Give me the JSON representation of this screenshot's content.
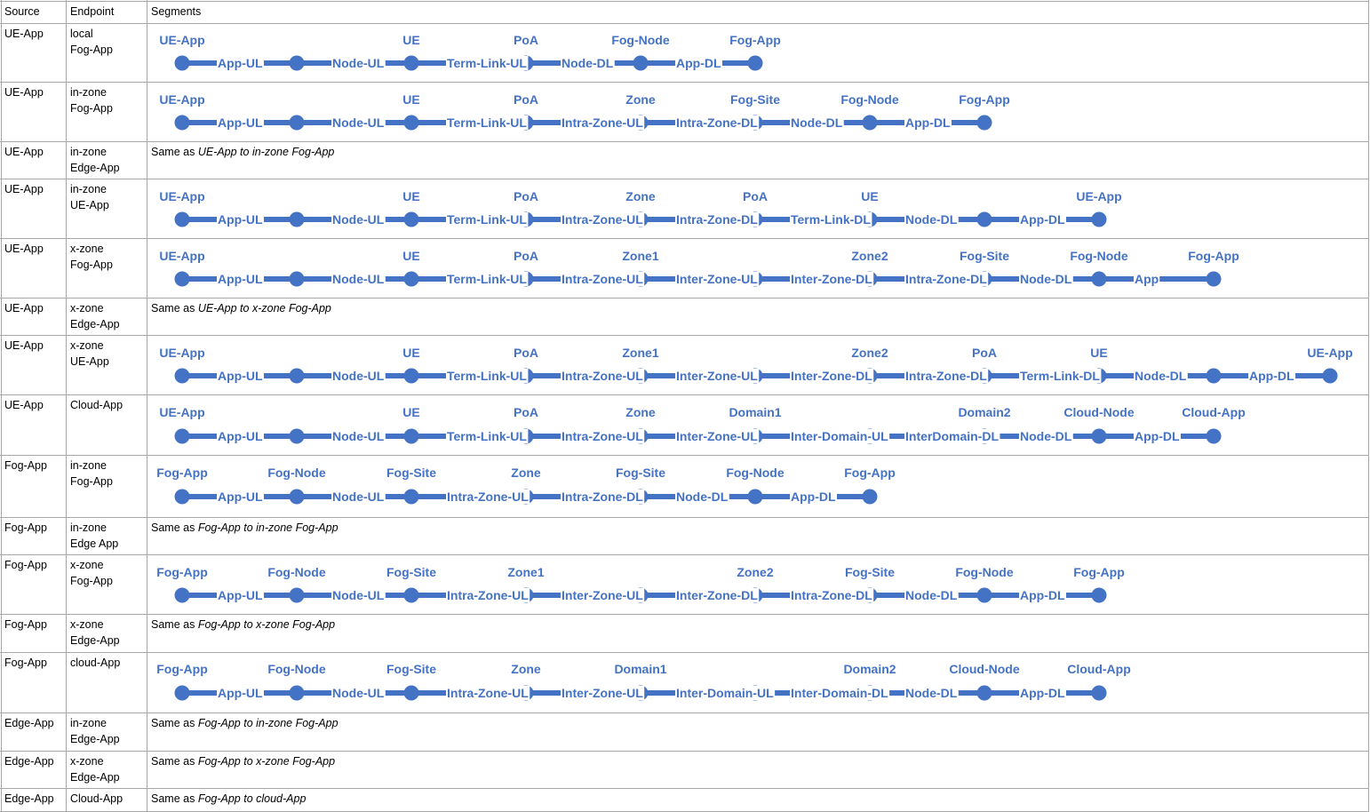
{
  "headers": {
    "source": "Source",
    "endpoint": "Endpoint",
    "segments": "Segments"
  },
  "colors": {
    "line": "#4472c4",
    "grid": "#a6a6a6"
  },
  "rows": [
    {
      "source": "UE-App",
      "endpoint": [
        "local",
        "Fog-App"
      ],
      "type": "diagram",
      "nodes": [
        "UE-App",
        "",
        "UE",
        "PoA",
        "Fog-Node",
        "Fog-App"
      ],
      "segments": [
        "App-UL",
        "Node-UL",
        "Term-Link-UL",
        "Node-DL",
        "App-DL"
      ]
    },
    {
      "source": "UE-App",
      "endpoint": [
        "in-zone",
        "Fog-App"
      ],
      "type": "diagram",
      "nodes": [
        "UE-App",
        "",
        "UE",
        "PoA",
        "Zone",
        "Fog-Site",
        "Fog-Node",
        "Fog-App"
      ],
      "segments": [
        "App-UL",
        "Node-UL",
        "Term-Link-UL",
        "Intra-Zone-UL",
        "Intra-Zone-DL",
        "Node-DL",
        "App-DL"
      ]
    },
    {
      "source": "UE-App",
      "endpoint": [
        "in-zone",
        "Edge-App"
      ],
      "type": "note",
      "note_prefix": "Same as ",
      "note_ref": "UE-App to in-zone Fog-App"
    },
    {
      "source": "UE-App",
      "endpoint": [
        "in-zone",
        "UE-App"
      ],
      "type": "diagram",
      "nodes": [
        "UE-App",
        "",
        "UE",
        "PoA",
        "Zone",
        "PoA",
        "UE",
        "",
        "UE-App"
      ],
      "segments": [
        "App-UL",
        "Node-UL",
        "Term-Link-UL",
        "Intra-Zone-UL",
        "Intra-Zone-DL",
        "Term-Link-DL",
        "Node-DL",
        "App-DL"
      ]
    },
    {
      "source": "UE-App",
      "endpoint": [
        "x-zone",
        "Fog-App"
      ],
      "type": "diagram",
      "nodes": [
        "UE-App",
        "",
        "UE",
        "PoA",
        "Zone1",
        "",
        "Zone2",
        "Fog-Site",
        "Fog-Node",
        "Fog-App"
      ],
      "segments": [
        "App-UL",
        "Node-UL",
        "Term-Link-UL",
        "Intra-Zone-UL",
        "Inter-Zone-UL",
        "Inter-Zone-DL",
        "Intra-Zone-DL",
        "Node-DL",
        "App"
      ]
    },
    {
      "source": "UE-App",
      "endpoint": [
        "x-zone",
        "Edge-App"
      ],
      "type": "note",
      "note_prefix": "Same as ",
      "note_ref": "UE-App to x-zone Fog-App"
    },
    {
      "source": "UE-App",
      "endpoint": [
        "x-zone",
        "UE-App"
      ],
      "type": "diagram",
      "nodes": [
        "UE-App",
        "",
        "UE",
        "PoA",
        "Zone1",
        "",
        "Zone2",
        "PoA",
        "UE",
        "",
        "UE-App"
      ],
      "segments": [
        "App-UL",
        "Node-UL",
        "Term-Link-UL",
        "Intra-Zone-UL",
        "Inter-Zone-UL",
        "Inter-Zone-DL",
        "Intra-Zone-DL",
        "Term-Link-DL",
        "Node-DL",
        "App-DL"
      ]
    },
    {
      "source": "UE-App",
      "endpoint": [
        "Cloud-App"
      ],
      "type": "diagram",
      "nodes": [
        "UE-App",
        "",
        "UE",
        "PoA",
        "Zone",
        "Domain1",
        "",
        "Domain2",
        "Cloud-Node",
        "Cloud-App"
      ],
      "segments": [
        "App-UL",
        "Node-UL",
        "Term-Link-UL",
        "Intra-Zone-UL",
        "Inter-Zone-UL",
        "Inter-Domain-UL",
        "InterDomain-DL",
        "Node-DL",
        "App-DL"
      ]
    },
    {
      "source": "Fog-App",
      "endpoint": [
        "in-zone",
        "Fog-App"
      ],
      "type": "diagram",
      "nodes": [
        "Fog-App",
        "Fog-Node",
        "Fog-Site",
        "Zone",
        "Fog-Site",
        "Fog-Node",
        "Fog-App"
      ],
      "segments": [
        "App-UL",
        "Node-UL",
        "Intra-Zone-UL",
        "Intra-Zone-DL",
        "Node-DL",
        "App-DL"
      ]
    },
    {
      "source": "Fog-App",
      "endpoint": [
        "in-zone",
        "Edge App"
      ],
      "type": "note",
      "note_prefix": "Same as ",
      "note_ref": "Fog-App to in-zone Fog-App"
    },
    {
      "source": "Fog-App",
      "endpoint": [
        "x-zone",
        "Fog-App"
      ],
      "type": "diagram",
      "nodes": [
        "Fog-App",
        "Fog-Node",
        "Fog-Site",
        "Zone1",
        "",
        "Zone2",
        "Fog-Site",
        "Fog-Node",
        "Fog-App"
      ],
      "segments": [
        "App-UL",
        "Node-UL",
        "Intra-Zone-UL",
        "Inter-Zone-UL",
        "Inter-Zone-DL",
        "Intra-Zone-DL",
        "Node-DL",
        "App-DL"
      ]
    },
    {
      "source": "Fog-App",
      "endpoint": [
        "x-zone",
        "Edge-App"
      ],
      "type": "note",
      "note_prefix": "Same as ",
      "note_ref": "Fog-App to x-zone Fog-App"
    },
    {
      "source": "Fog-App",
      "endpoint": [
        "cloud-App"
      ],
      "type": "diagram",
      "nodes": [
        "Fog-App",
        "Fog-Node",
        "Fog-Site",
        "Zone",
        "Domain1",
        "",
        "Domain2",
        "Cloud-Node",
        "Cloud-App"
      ],
      "segments": [
        "App-UL",
        "Node-UL",
        "Intra-Zone-UL",
        "Inter-Zone-UL",
        "Inter-Domain-UL",
        "Inter-Domain-DL",
        "Node-DL",
        "App-DL"
      ]
    },
    {
      "source": "Edge-App",
      "endpoint": [
        "in-zone",
        "Edge-App"
      ],
      "type": "note",
      "note_prefix": "Same as ",
      "note_ref": "Fog-App to in-zone Fog-App"
    },
    {
      "source": "Edge-App",
      "endpoint": [
        "x-zone",
        "Edge-App"
      ],
      "type": "note",
      "note_prefix": "Same as ",
      "note_ref": "Fog-App to x-zone Fog-App"
    },
    {
      "source": "Edge-App",
      "endpoint": [
        "Cloud-App"
      ],
      "type": "note",
      "note_prefix": "Same as ",
      "note_ref": "Fog-App to cloud-App"
    }
  ]
}
